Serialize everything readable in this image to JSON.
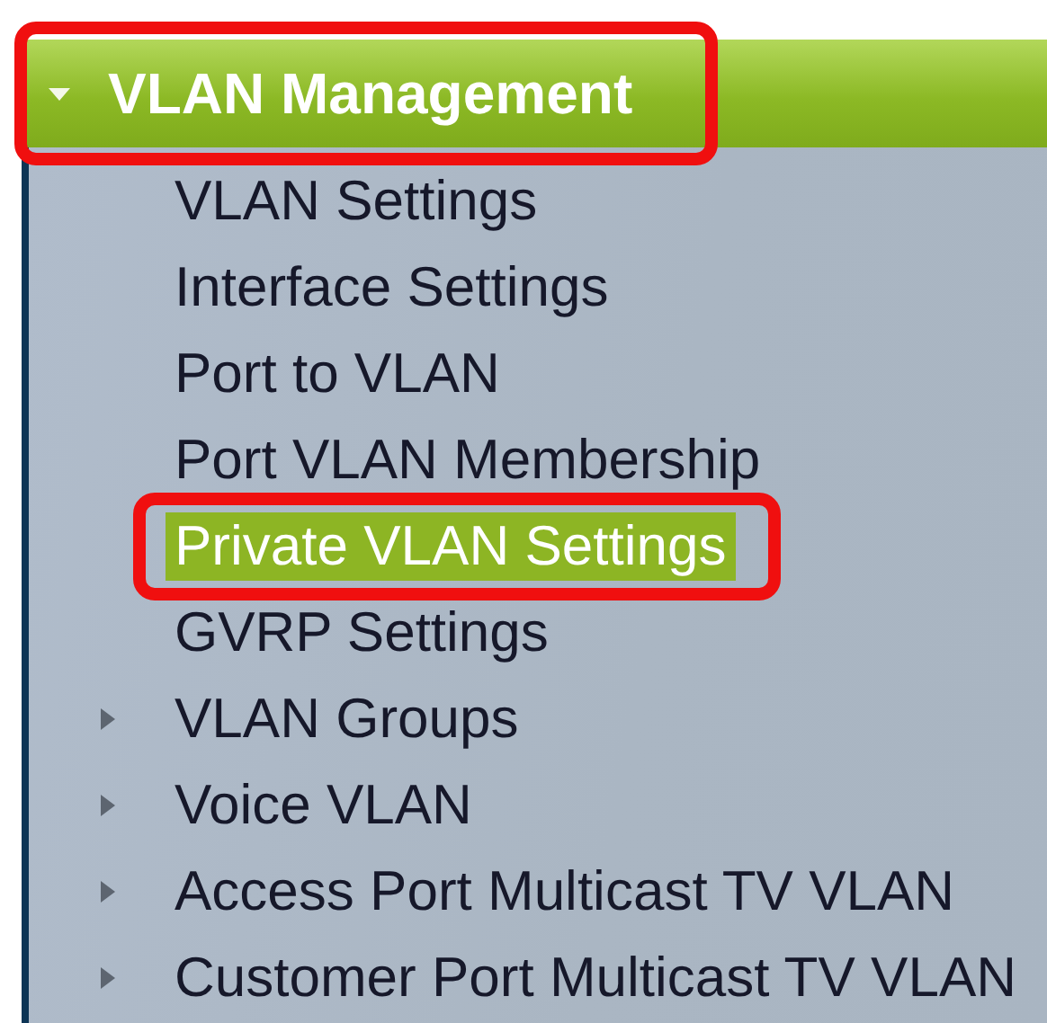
{
  "menu": {
    "title": "VLAN Management",
    "expanded": true,
    "annotated": true,
    "items": [
      {
        "label": "VLAN Settings",
        "kind": "page",
        "selected": false,
        "annotated": false
      },
      {
        "label": "Interface Settings",
        "kind": "page",
        "selected": false,
        "annotated": false
      },
      {
        "label": "Port to VLAN",
        "kind": "page",
        "selected": false,
        "annotated": false
      },
      {
        "label": "Port VLAN Membership",
        "kind": "page",
        "selected": false,
        "annotated": false
      },
      {
        "label": "Private VLAN Settings",
        "kind": "page",
        "selected": true,
        "annotated": true
      },
      {
        "label": "GVRP Settings",
        "kind": "page",
        "selected": false,
        "annotated": false
      },
      {
        "label": "VLAN Groups",
        "kind": "folder",
        "expanded": false,
        "selected": false,
        "annotated": false
      },
      {
        "label": "Voice VLAN",
        "kind": "folder",
        "expanded": false,
        "selected": false,
        "annotated": false
      },
      {
        "label": "Access Port Multicast TV VLAN",
        "kind": "folder",
        "expanded": false,
        "selected": false,
        "annotated": false
      },
      {
        "label": "Customer Port Multicast TV VLAN",
        "kind": "folder",
        "expanded": false,
        "selected": false,
        "annotated": false
      }
    ]
  }
}
